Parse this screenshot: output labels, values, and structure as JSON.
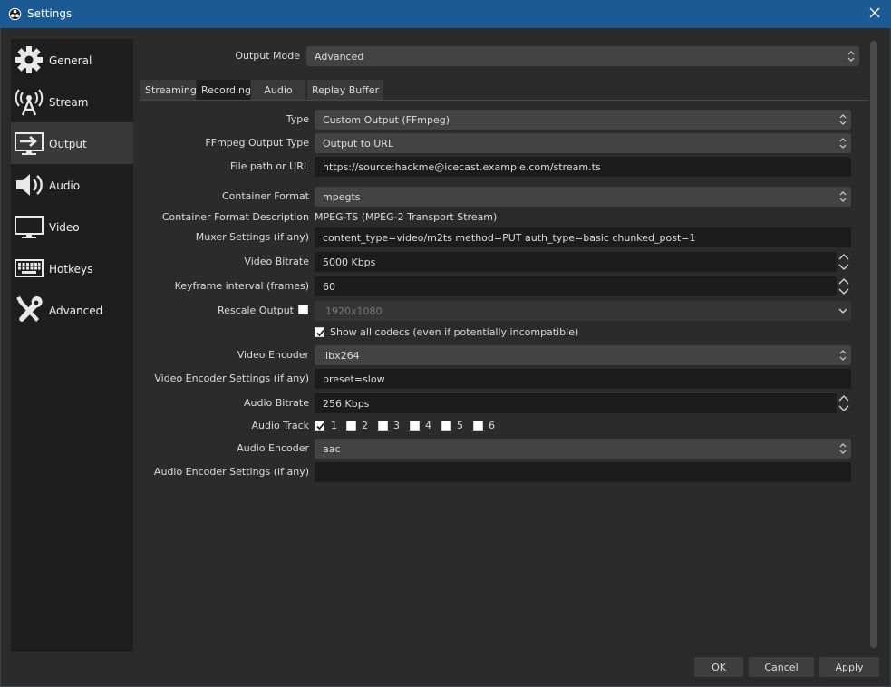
{
  "window": {
    "title": "Settings"
  },
  "sidebar": {
    "items": [
      {
        "label": "General",
        "icon": "gear-icon"
      },
      {
        "label": "Stream",
        "icon": "antenna-icon"
      },
      {
        "label": "Output",
        "icon": "monitor-arrow-icon"
      },
      {
        "label": "Audio",
        "icon": "speaker-icon"
      },
      {
        "label": "Video",
        "icon": "monitor-icon"
      },
      {
        "label": "Hotkeys",
        "icon": "keyboard-icon"
      },
      {
        "label": "Advanced",
        "icon": "tools-icon"
      }
    ],
    "active": "Output"
  },
  "output_mode": {
    "label": "Output Mode",
    "value": "Advanced"
  },
  "tabs": [
    "Streaming",
    "Recording",
    "Audio",
    "Replay Buffer"
  ],
  "active_tab": "Recording",
  "form": {
    "type": {
      "label": "Type",
      "value": "Custom Output (FFmpeg)"
    },
    "ffmpeg_output_type": {
      "label": "FFmpeg Output Type",
      "value": "Output to URL"
    },
    "file_path": {
      "label": "File path or URL",
      "value": "https://source:hackme@icecast.example.com/stream.ts"
    },
    "container_format": {
      "label": "Container Format",
      "value": "mpegts"
    },
    "container_desc": {
      "label": "Container Format Description",
      "value": "MPEG-TS (MPEG-2 Transport Stream)"
    },
    "muxer_settings": {
      "label": "Muxer Settings (if any)",
      "value": "content_type=video/m2ts method=PUT auth_type=basic chunked_post=1"
    },
    "video_bitrate": {
      "label": "Video Bitrate",
      "value": "5000 Kbps"
    },
    "keyframe_interval": {
      "label": "Keyframe interval (frames)",
      "value": "60"
    },
    "rescale_output": {
      "label": "Rescale Output",
      "checked": false,
      "value": "1920x1080"
    },
    "show_all_codecs": {
      "label": "Show all codecs (even if potentially incompatible)",
      "checked": true
    },
    "video_encoder": {
      "label": "Video Encoder",
      "value": "libx264"
    },
    "video_encoder_settings": {
      "label": "Video Encoder Settings (if any)",
      "value": "preset=slow"
    },
    "audio_bitrate": {
      "label": "Audio Bitrate",
      "value": "256 Kbps"
    },
    "audio_track": {
      "label": "Audio Track",
      "tracks": [
        {
          "label": "1",
          "checked": true
        },
        {
          "label": "2",
          "checked": false
        },
        {
          "label": "3",
          "checked": false
        },
        {
          "label": "4",
          "checked": false
        },
        {
          "label": "5",
          "checked": false
        },
        {
          "label": "6",
          "checked": false
        }
      ]
    },
    "audio_encoder": {
      "label": "Audio Encoder",
      "value": "aac"
    },
    "audio_encoder_settings": {
      "label": "Audio Encoder Settings (if any)",
      "value": ""
    }
  },
  "buttons": {
    "ok": "OK",
    "cancel": "Cancel",
    "apply": "Apply"
  }
}
